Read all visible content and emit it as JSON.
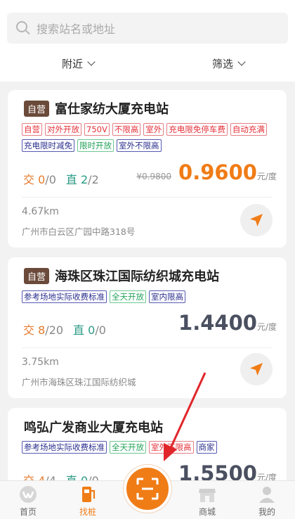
{
  "search": {
    "placeholder": "搜索站名或地址"
  },
  "filters": {
    "nearby": "附近",
    "screen": "筛选"
  },
  "stations": [
    {
      "self_badge": "自营",
      "name": "富仕家纺大厦充电站",
      "tags": [
        {
          "text": "自营",
          "color": "red"
        },
        {
          "text": "对外开放",
          "color": "red"
        },
        {
          "text": "750V",
          "color": "red"
        },
        {
          "text": "不限高",
          "color": "red"
        },
        {
          "text": "室外",
          "color": "red"
        },
        {
          "text": "充电限免停车费",
          "color": "red"
        },
        {
          "text": "自动充满",
          "color": "red"
        },
        {
          "text": "充电限时减免",
          "color": "blue"
        },
        {
          "text": "限时开放",
          "color": "green"
        },
        {
          "text": "室外不限高",
          "color": "blue"
        }
      ],
      "ac_label": "交",
      "ac_free": "0",
      "ac_total": "/0",
      "dc_label": "直",
      "dc_free": "2",
      "dc_total": "/2",
      "old_price": "¥0.9800",
      "price": "0.9600",
      "unit": "元/度",
      "distance": "4.67km",
      "address": "广州市白云区广园中路318号"
    },
    {
      "self_badge": "自营",
      "name": "海珠区珠江国际纺织城充电站",
      "tags": [
        {
          "text": "参考场地实际收费标准",
          "color": "blue"
        },
        {
          "text": "全天开放",
          "color": "green"
        },
        {
          "text": "室内限高",
          "color": "blue"
        }
      ],
      "ac_label": "交",
      "ac_free": "8",
      "ac_total": "/20",
      "dc_label": "直",
      "dc_free": "0",
      "dc_total": "/0",
      "price": "1.4400",
      "unit": "元/度",
      "distance": "3.75km",
      "address": "广州市海珠区珠江国际纺织城"
    },
    {
      "name": "鸣弘广发商业大厦充电站",
      "tags": [
        {
          "text": "参考场地实际收费标准",
          "color": "blue"
        },
        {
          "text": "全天开放",
          "color": "green"
        },
        {
          "text": "室外不限高",
          "color": "red"
        },
        {
          "text": "商家",
          "color": "blue"
        }
      ],
      "ac_label": "交",
      "ac_free": "4",
      "ac_total": "/4",
      "dc_label": "直",
      "dc_free": "0",
      "dc_total": "/0",
      "price": "1.5500",
      "unit": "元/度"
    }
  ],
  "tabbar": {
    "home": "首页",
    "find": "找桩",
    "mall": "商城",
    "mine": "我的"
  },
  "colors": {
    "accent": "#f07c16",
    "tag_red": "#e5313a",
    "tag_blue": "#2b2f8f",
    "tag_green": "#23a35a",
    "annotation_arrow": "#e0262b"
  },
  "icons": [
    "search-icon",
    "chevron-down-icon",
    "navigate-icon",
    "home-icon",
    "charger-icon",
    "scan-icon",
    "shop-icon",
    "user-icon"
  ]
}
